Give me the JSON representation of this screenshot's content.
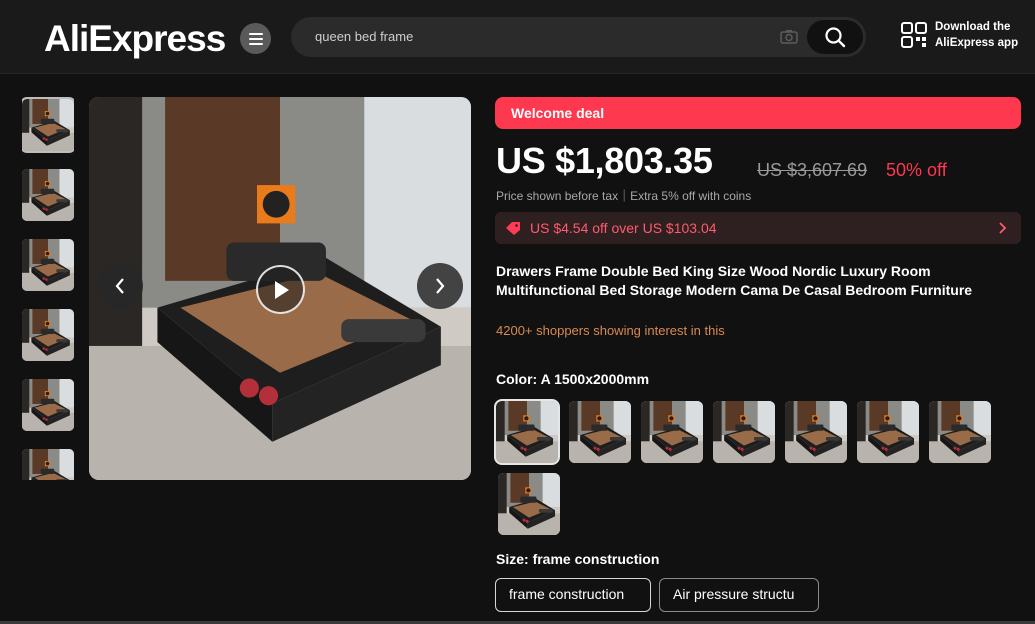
{
  "header": {
    "logo": "AliExpress",
    "search_value": "queen bed frame",
    "app_line1": "Download the",
    "app_line2": "AliExpress app"
  },
  "deal": {
    "label": "Welcome deal"
  },
  "price": {
    "current": "US $1,803.35",
    "original": "US $3,607.69",
    "discount": "50% off",
    "note": "Price shown before tax｜Extra 5% off with coins"
  },
  "coupon": {
    "text": "US $4.54 off over US $103.04"
  },
  "product": {
    "title": "Drawers Frame Double Bed King Size Wood Nordic Luxury Room Multifunctional Bed Storage Modern Cama De Casal Bedroom Furniture",
    "interest": "4200+ shoppers showing interest in this"
  },
  "color": {
    "label": "Color: A 1500x2000mm",
    "selected_index": 0,
    "option_count": 8
  },
  "size": {
    "label": "Size: frame construction",
    "options": [
      "frame construction",
      "Air pressure structu"
    ]
  },
  "colors": {
    "accent": "#fd384f",
    "interest": "#d98a52",
    "background": "#111111"
  },
  "icons": {
    "menu": "menu-icon",
    "camera": "camera-icon",
    "search": "search-icon",
    "qr": "qr-code-icon",
    "coupon": "coupon-tag-icon",
    "prev": "chevron-left-icon",
    "next": "chevron-right-icon",
    "play": "play-icon"
  }
}
